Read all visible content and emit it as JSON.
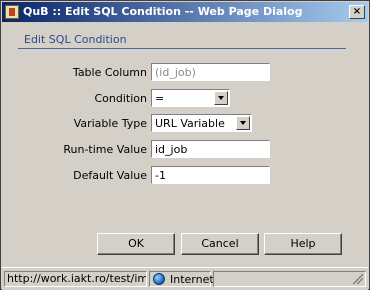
{
  "window": {
    "title": "QuB :: Edit SQL Condition -- Web Page Dialog",
    "close_label": "×"
  },
  "section": {
    "title": "Edit SQL Condition"
  },
  "form": {
    "table_column": {
      "label": "Table Column",
      "value": "(id_job)"
    },
    "condition": {
      "label": "Condition",
      "selected": "="
    },
    "variable_type": {
      "label": "Variable Type",
      "selected": "URL Variable"
    },
    "runtime_value": {
      "label": "Run-time Value",
      "value": "id_job"
    },
    "default_value": {
      "label": "Default Value",
      "value": "-1"
    }
  },
  "buttons": {
    "ok": "OK",
    "cancel": "Cancel",
    "help": "Help"
  },
  "statusbar": {
    "url": "http://work.iakt.ro/test/imc/jc",
    "zone": "Internet"
  },
  "icons": {
    "app": "qub-app-icon",
    "close": "close-icon",
    "zone": "globe-icon"
  },
  "colors": {
    "titlebar_start": "#0a246a",
    "titlebar_end": "#a6caf0",
    "section_title": "#2b4b8c",
    "face": "#d4d0c8"
  }
}
